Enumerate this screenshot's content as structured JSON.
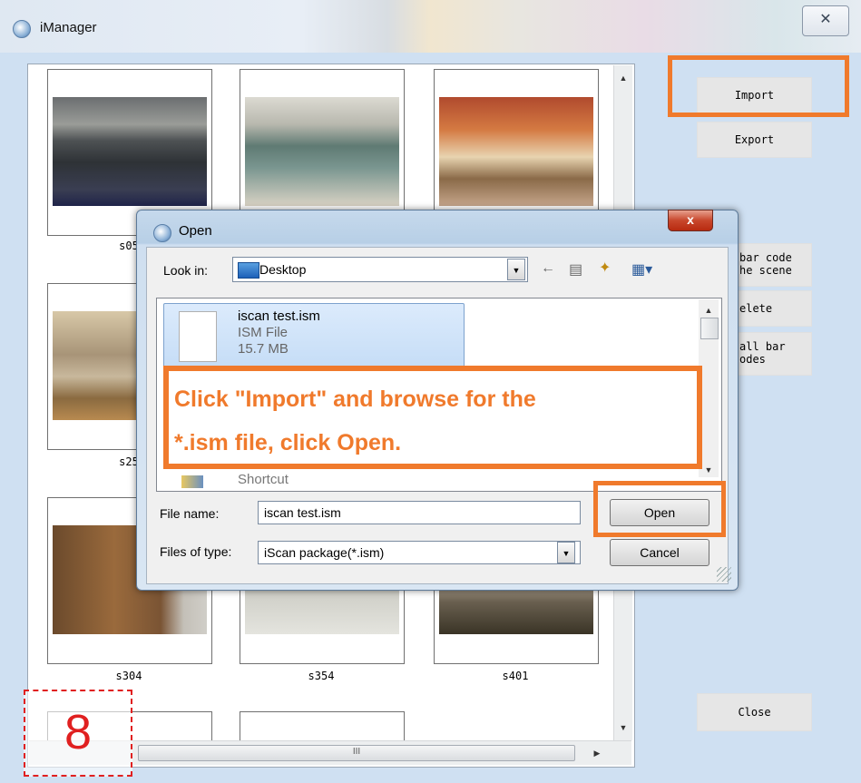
{
  "window": {
    "title": "iManager",
    "close_glyph": "✕"
  },
  "thumbnails": [
    {
      "caption": "s05",
      "image": "kitchen"
    },
    {
      "caption": "",
      "image": "kitchen"
    },
    {
      "caption": "",
      "image": "bedroom"
    },
    {
      "caption": "s25",
      "image": "living-room"
    },
    {
      "caption": "",
      "image": "room"
    },
    {
      "caption": "",
      "image": "room"
    },
    {
      "caption": "s304",
      "image": "bathroom"
    },
    {
      "caption": "s354",
      "image": "living-room"
    },
    {
      "caption": "s401",
      "image": "living-room"
    }
  ],
  "right_panel": {
    "import": "Import",
    "export": "Export",
    "barcode_line1": "bar code",
    "barcode_line2": "he scene",
    "delete": "elete",
    "allbar_line1": "all bar",
    "allbar_line2": "odes",
    "close": "Close"
  },
  "hscroll": {
    "thumb_glyph": "III"
  },
  "open_dialog": {
    "title": "Open",
    "close_glyph": "x",
    "look_in_label": "Look in:",
    "look_in_value": "Desktop",
    "file": {
      "name": "iscan test.ism",
      "type": "ISM File",
      "size": "15.7 MB"
    },
    "shortcut_label": "Shortcut",
    "file_name_label": "File name:",
    "file_name_value": "iscan test.ism",
    "files_of_type_label": "Files of type:",
    "files_of_type_value": "iScan package(*.ism)",
    "open_button": "Open",
    "cancel_button": "Cancel"
  },
  "annotation": {
    "line1": "Click \"Import\" and browse for the",
    "line2": "*.ism file, click Open.",
    "accent_color": "#f07a2c"
  },
  "step_number": "8"
}
